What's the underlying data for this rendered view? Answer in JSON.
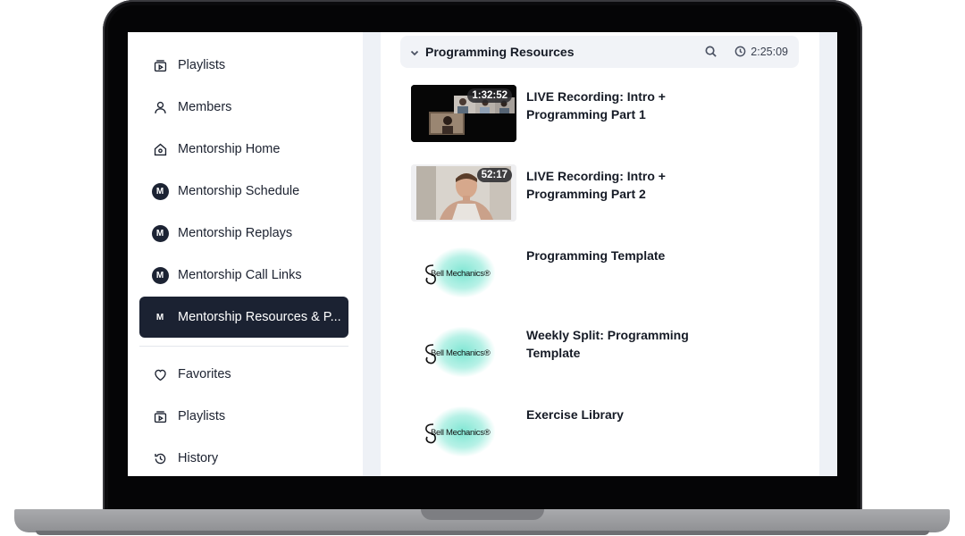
{
  "sidebar": {
    "items": [
      {
        "label": "Playlists",
        "icon": "playlist-icon"
      },
      {
        "label": "Members",
        "icon": "person-icon"
      },
      {
        "label": "Mentorship Home",
        "icon": "home-icon"
      },
      {
        "label": "Mentorship Schedule",
        "icon": "m-badge-icon",
        "badge": "M"
      },
      {
        "label": "Mentorship Replays",
        "icon": "m-badge-icon",
        "badge": "M"
      },
      {
        "label": "Mentorship Call Links",
        "icon": "m-badge-icon",
        "badge": "M"
      },
      {
        "label": "Mentorship Resources & P...",
        "icon": "m-badge-icon",
        "badge": "M",
        "active": true
      }
    ],
    "secondary": [
      {
        "label": "Favorites",
        "icon": "heart-icon"
      },
      {
        "label": "Playlists",
        "icon": "playlist-icon"
      },
      {
        "label": "History",
        "icon": "history-icon"
      }
    ]
  },
  "section": {
    "title": "Programming Resources",
    "duration": "2:25:09"
  },
  "lessons": [
    {
      "title": "LIVE Recording: Intro + Programming Part 1",
      "duration": "1:32:52",
      "thumb": "video"
    },
    {
      "title": "LIVE Recording: Intro + Programming Part 2",
      "duration": "52:17",
      "thumb": "video"
    },
    {
      "title": "Programming Template",
      "thumb": "brand",
      "brand": "Bell Mechanics®"
    },
    {
      "title": "Weekly Split: Programming Template",
      "thumb": "brand",
      "brand": "Bell Mechanics®"
    },
    {
      "title": "Exercise Library",
      "thumb": "brand",
      "brand": "Bell Mechanics®"
    }
  ],
  "colors": {
    "active_bg": "#1b2232",
    "screen_bg": "#eef1f6",
    "brand_accent": "#7fe6d3"
  }
}
